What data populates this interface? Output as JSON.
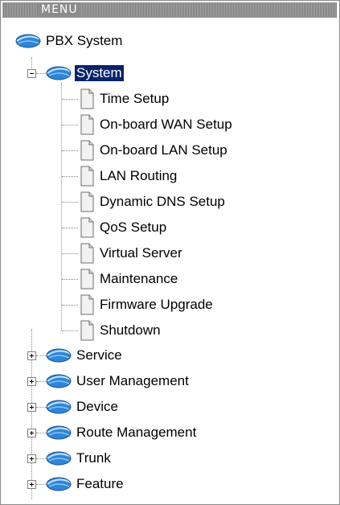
{
  "header": {
    "title": "MENU"
  },
  "root": {
    "label": "PBX System",
    "icon": "network-globe-icon"
  },
  "system": {
    "label": "System",
    "expanded": true,
    "selected": true,
    "children": [
      "Time Setup",
      "On-board WAN Setup",
      "On-board LAN Setup",
      "LAN Routing",
      "Dynamic DNS Setup",
      "QoS Setup",
      "Virtual Server",
      "Maintenance",
      "Firmware Upgrade",
      "Shutdown"
    ]
  },
  "collapsed_sections": [
    "Service",
    "User Management",
    "Device",
    "Route Management",
    "Trunk",
    "Feature"
  ],
  "colors": {
    "selection_bg": "#0a246a",
    "selection_text": "#ffffff",
    "header_bg": "#8c8c8c",
    "globe_blue": "#2f86d8"
  }
}
